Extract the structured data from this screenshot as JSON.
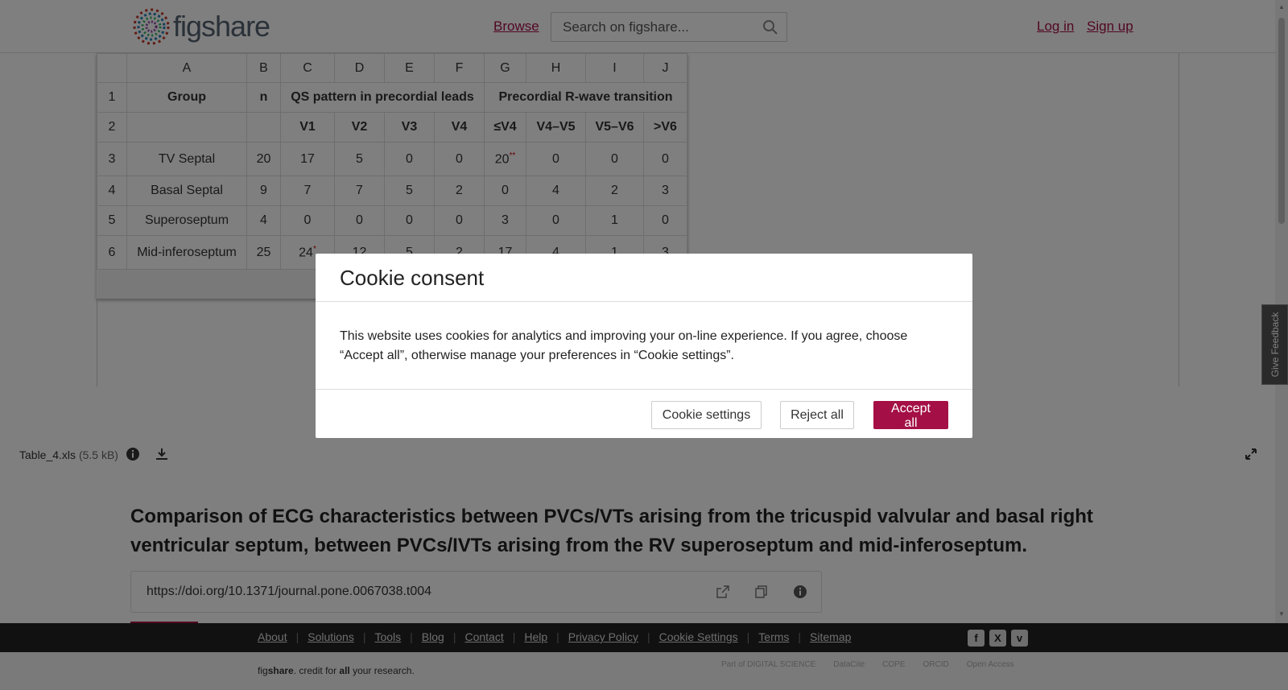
{
  "header": {
    "brand": "figshare",
    "browse": "Browse",
    "search_placeholder": "Search on figshare...",
    "login": "Log in",
    "signup": "Sign up"
  },
  "spreadsheet": {
    "columns": [
      "A",
      "B",
      "C",
      "D",
      "E",
      "F",
      "G",
      "H",
      "I",
      "J"
    ],
    "row1": {
      "num": "1",
      "group": "Group",
      "n": "n",
      "qs": "QS pattern in precordial leads",
      "transition": "Precordial R-wave transition"
    },
    "row2": {
      "num": "2",
      "cells": [
        "V1",
        "V2",
        "V3",
        "V4",
        "≤V4",
        "V4–V5",
        "V5–V6",
        ">V6"
      ]
    },
    "rows": [
      {
        "num": "3",
        "group": "TV Septal",
        "n": "20",
        "v1": "17",
        "v2": "5",
        "v3": "0",
        "v4": "0",
        "le_v4": "20",
        "le_v4_mark": "**",
        "v4v5": "0",
        "v5v6": "0",
        "gt_v6": "0"
      },
      {
        "num": "4",
        "group": "Basal Septal",
        "n": "9",
        "v1": "7",
        "v2": "7",
        "v3": "5",
        "v4": "2",
        "le_v4": "0",
        "v4v5": "4",
        "v5v6": "2",
        "gt_v6": "3"
      },
      {
        "num": "5",
        "group": "Superoseptum",
        "n": "4",
        "v1": "0",
        "v2": "0",
        "v3": "0",
        "v4": "0",
        "le_v4": "3",
        "v4v5": "0",
        "v5v6": "1",
        "gt_v6": "0"
      },
      {
        "num": "6",
        "group": "Mid-inferoseptum",
        "n": "25",
        "v1": "24",
        "v1_mark": "*",
        "v2": "12",
        "v3": "5",
        "v4": "2",
        "le_v4": "17",
        "v4v5": "4",
        "v5v6": "1",
        "gt_v6": "3"
      }
    ]
  },
  "file": {
    "name": "Table_4.xls",
    "size": "(5.5 kB)"
  },
  "main": {
    "title": "Comparison of ECG characteristics between PVCs/VTs arising from the tricuspid valvular and basal right ventricular septum, between PVCs/IVTs arising from the RV superoseptum and mid-inferoseptum.",
    "doi": "https://doi.org/10.1371/journal.pone.0067038.t004"
  },
  "footer": {
    "links": [
      "About",
      "Solutions",
      "Tools",
      "Blog",
      "Contact",
      "Help",
      "Privacy Policy",
      "Cookie Settings",
      "Terms",
      "Sitemap"
    ],
    "tagline_pre": "fig",
    "tagline_brand": "share",
    "tagline_mid": ". credit for ",
    "tagline_all": "all",
    "tagline_post": " your research.",
    "partners": [
      "Part of DIGITAL SCIENCE",
      "DataCite",
      "COPE",
      "ORCID",
      "Open Access"
    ]
  },
  "feedback": "Give Feedback",
  "cookie": {
    "title": "Cookie consent",
    "body": "This website uses cookies for analytics and improving your on-line experience. If you agree, choose “Accept all”, otherwise manage your preferences in “Cookie settings”.",
    "settings": "Cookie settings",
    "reject": "Reject all",
    "accept": "Accept all"
  },
  "colors": {
    "brand": "#a40f45",
    "footer_bg": "#222222"
  }
}
